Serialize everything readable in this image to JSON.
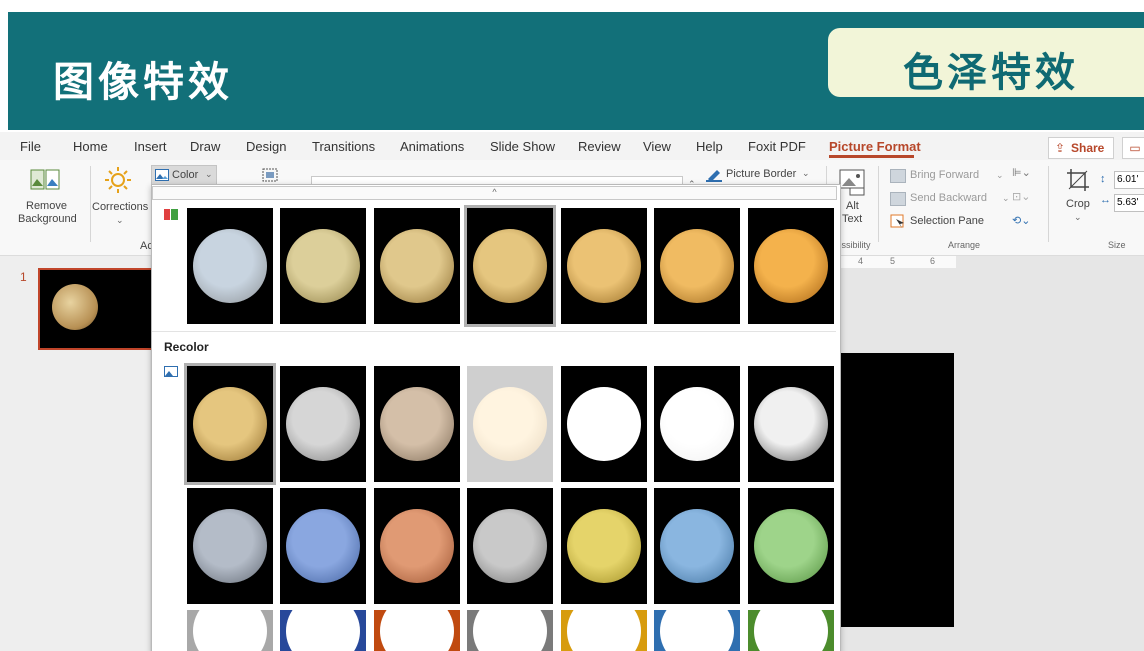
{
  "banner": {
    "title_left": "图像特效",
    "title_right": "色泽特效"
  },
  "ribbon_tabs": [
    {
      "label": "File"
    },
    {
      "label": "Home"
    },
    {
      "label": "Insert"
    },
    {
      "label": "Draw"
    },
    {
      "label": "Design"
    },
    {
      "label": "Transitions"
    },
    {
      "label": "Animations"
    },
    {
      "label": "Slide Show"
    },
    {
      "label": "Review"
    },
    {
      "label": "View"
    },
    {
      "label": "Help"
    },
    {
      "label": "Foxit PDF"
    },
    {
      "label": "Picture Format",
      "active": true
    }
  ],
  "share": {
    "label": "Share"
  },
  "ribbon": {
    "remove_bg": {
      "line1": "Remove",
      "line2": "Background"
    },
    "corrections": {
      "label": "Corrections"
    },
    "color": {
      "label": "Color"
    },
    "group_adjust_fragment": "Ac",
    "picture_border": {
      "label": "Picture Border"
    },
    "alt_text": {
      "line1": "Alt",
      "line2": "Text"
    },
    "accessibility_fragment": "cessibility",
    "bring_forward": {
      "label": "Bring Forward"
    },
    "send_backward": {
      "label": "Send Backward"
    },
    "selection_pane": {
      "label": "Selection Pane"
    },
    "arrange_group": "Arrange",
    "crop": {
      "label": "Crop"
    },
    "height_value": "6.01'",
    "width_value": "5.63'",
    "size_group": "Size"
  },
  "slide": {
    "number": "1"
  },
  "ruler": {
    "ticks": [
      "4",
      "5",
      "6"
    ]
  },
  "dropdown": {
    "recolor_label": "Recolor",
    "saturation_row": [
      {
        "color": "#c8d4e0",
        "edge": "#8a8f93",
        "selected": false
      },
      {
        "color": "#dccf9a",
        "edge": "#8a7a40",
        "selected": false
      },
      {
        "color": "#e0c88c",
        "edge": "#8c6d30",
        "selected": false
      },
      {
        "color": "#e5c67f",
        "edge": "#8f6a28",
        "selected": true
      },
      {
        "color": "#ebc274",
        "edge": "#946a22",
        "selected": false
      },
      {
        "color": "#f0bb62",
        "edge": "#9a651a",
        "selected": false
      },
      {
        "color": "#f4b24c",
        "edge": "#a15e10",
        "selected": false
      }
    ],
    "recolor_row1": [
      {
        "color": "#e5c67f",
        "edge": "#8f6a28",
        "bg": "#000000",
        "selected": true
      },
      {
        "color": "#d6d6d6",
        "edge": "#7a7a7a",
        "bg": "#000000",
        "selected": false
      },
      {
        "color": "#d4bfa8",
        "edge": "#7d6a55",
        "bg": "#000000",
        "selected": false
      },
      {
        "color": "#fff4e0",
        "edge": "#e8d8c0",
        "bg": "#cfcfcf",
        "selected": false
      },
      {
        "color": "#ffffff",
        "edge": "#ffffff",
        "bg": "#000000",
        "selected": false
      },
      {
        "color": "#ffffff",
        "edge": "#f0f0f0",
        "bg": "#000000",
        "selected": false
      },
      {
        "color": "#f0f0f0",
        "edge": "#555555",
        "bg": "#000000",
        "selected": false
      }
    ],
    "recolor_row2": [
      {
        "color": "#b4bcc8",
        "edge": "#5f6670",
        "bg": "#000000"
      },
      {
        "color": "#8aa7e0",
        "edge": "#3f5e9c",
        "bg": "#000000"
      },
      {
        "color": "#e09a74",
        "edge": "#9a5230",
        "bg": "#000000"
      },
      {
        "color": "#c9c9c9",
        "edge": "#6f6f6f",
        "bg": "#000000"
      },
      {
        "color": "#e5d46a",
        "edge": "#9c8a20",
        "bg": "#000000"
      },
      {
        "color": "#8ab6e0",
        "edge": "#3e6f9c",
        "bg": "#000000"
      },
      {
        "color": "#9ed48a",
        "edge": "#4f8c3a",
        "bg": "#000000"
      }
    ],
    "recolor_row3": [
      {
        "color": "#ffffff",
        "bg": "#a8a8a8"
      },
      {
        "color": "#ffffff",
        "bg": "#27489a"
      },
      {
        "color": "#ffffff",
        "bg": "#c04a10"
      },
      {
        "color": "#ffffff",
        "bg": "#7a7a7a"
      },
      {
        "color": "#ffffff",
        "bg": "#d79c0e"
      },
      {
        "color": "#ffffff",
        "bg": "#2f6fb0"
      },
      {
        "color": "#ffffff",
        "bg": "#4c8c2c"
      }
    ]
  }
}
